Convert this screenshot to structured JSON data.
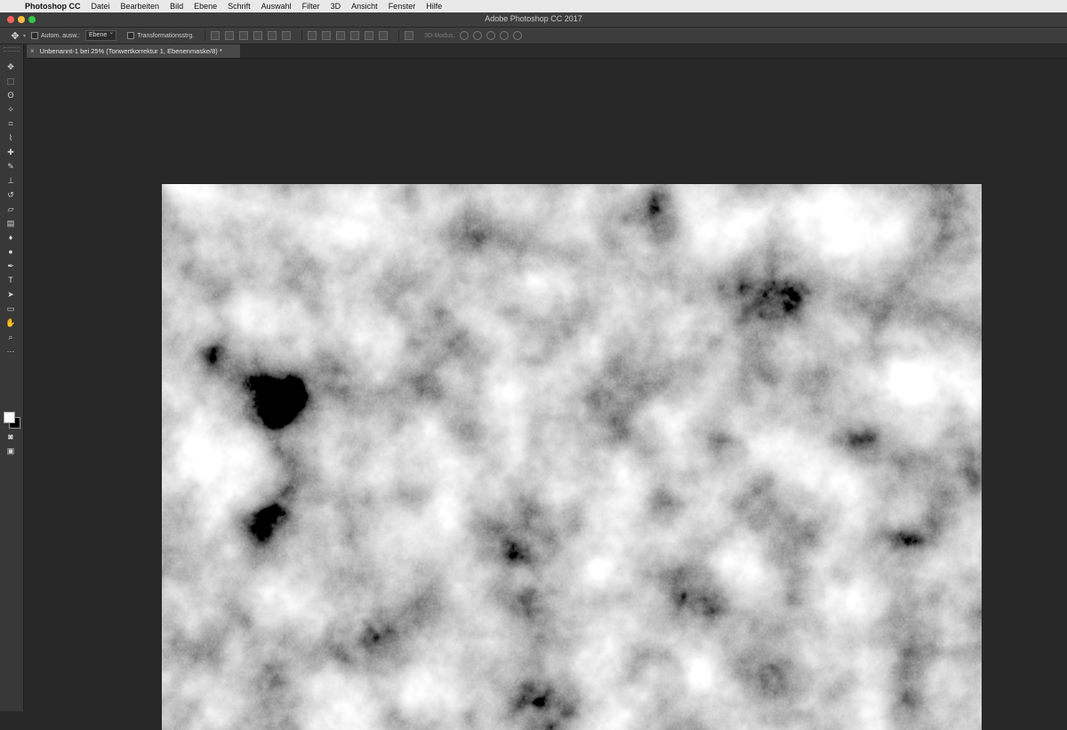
{
  "menubar": {
    "apple": "",
    "items": [
      "Photoshop CC",
      "Datei",
      "Bearbeiten",
      "Bild",
      "Ebene",
      "Schrift",
      "Auswahl",
      "Filter",
      "3D",
      "Ansicht",
      "Fenster",
      "Hilfe"
    ]
  },
  "window": {
    "title": "Adobe Photoshop CC 2017"
  },
  "options": {
    "auto_select_label": "Autom. ausw.:",
    "auto_select_value": "Ebene",
    "transform_label": "Transformationsstrg.",
    "mode_3d_label": "3D-Modus:"
  },
  "document": {
    "tab_title": "Unbenannt-1 bei 25% (Tonwertkorrektur 1, Ebenenmaske/8) *",
    "close_glyph": "×"
  },
  "toolbar": {
    "tools": [
      {
        "name": "move-tool",
        "glyph": "✥"
      },
      {
        "name": "marquee-tool",
        "glyph": "⬚"
      },
      {
        "name": "lasso-tool",
        "glyph": "ʘ"
      },
      {
        "name": "magic-wand-tool",
        "glyph": "✧"
      },
      {
        "name": "crop-tool",
        "glyph": "⌗"
      },
      {
        "name": "eyedropper-tool",
        "glyph": "⌇"
      },
      {
        "name": "healing-brush-tool",
        "glyph": "✚"
      },
      {
        "name": "brush-tool",
        "glyph": "✎"
      },
      {
        "name": "clone-stamp-tool",
        "glyph": "⊥"
      },
      {
        "name": "history-brush-tool",
        "glyph": "↺"
      },
      {
        "name": "eraser-tool",
        "glyph": "▱"
      },
      {
        "name": "gradient-tool",
        "glyph": "▤"
      },
      {
        "name": "blur-tool",
        "glyph": "♦"
      },
      {
        "name": "dodge-tool",
        "glyph": "●"
      },
      {
        "name": "pen-tool",
        "glyph": "✒"
      },
      {
        "name": "type-tool",
        "glyph": "T"
      },
      {
        "name": "path-selection-tool",
        "glyph": "➤"
      },
      {
        "name": "shape-tool",
        "glyph": "▭"
      },
      {
        "name": "hand-tool",
        "glyph": "✋"
      },
      {
        "name": "zoom-tool",
        "glyph": "⌕"
      },
      {
        "name": "more-tools",
        "glyph": "⋯"
      }
    ],
    "quickmask_glyph": "◙",
    "screenmode_glyph": "▣"
  },
  "colors": {
    "foreground": "#ffffff",
    "background": "#000000"
  }
}
